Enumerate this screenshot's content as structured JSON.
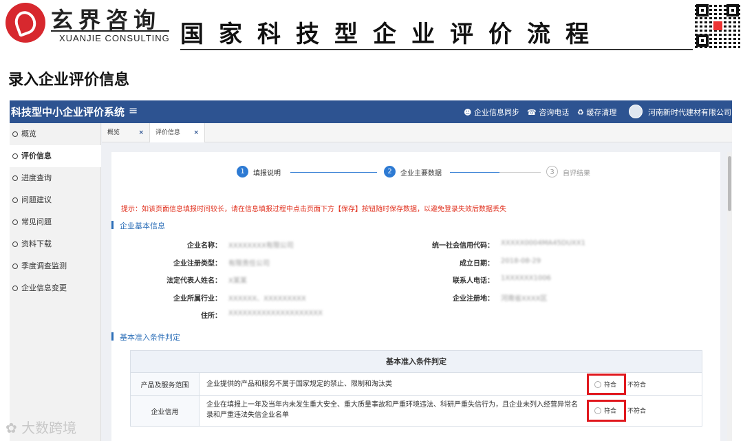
{
  "banner": {
    "brand_cn": "玄界咨询",
    "brand_en": "XUANJIE CONSULTING",
    "title": "国家科技型企业评价流程"
  },
  "section_heading": "录入企业评价信息",
  "app": {
    "system_title": "科技型中小企业评价系统",
    "menu_icon": "≡",
    "nav": [
      {
        "icon": "user-icon",
        "label": "企业信息同步"
      },
      {
        "icon": "phone-icon",
        "label": "咨询电话"
      },
      {
        "icon": "recycle-icon",
        "label": "缓存清理"
      }
    ],
    "company": "河南新时代建材有限公司",
    "sidebar": [
      "概览",
      "评价信息",
      "进度查询",
      "问题建议",
      "常见问题",
      "资料下载",
      "季度调查监测",
      "企业信息变更"
    ],
    "sidebar_active": "评价信息",
    "tabs": [
      {
        "label": "概览",
        "close": "×"
      },
      {
        "label": "评价信息",
        "close": "×"
      }
    ],
    "steps": [
      {
        "num": "1",
        "label": "填报说明"
      },
      {
        "num": "2",
        "label": "企业主要数据"
      },
      {
        "num": "3",
        "label": "自评结果"
      }
    ],
    "hint": "提示：如该页面信息填报时间较长，请在信息填报过程中点击页面下方【保存】按钮随时保存数据，以避免登录失效后数据丢失",
    "basic_info_title": "企业基本信息",
    "fields_left": [
      {
        "label": "企业名称：",
        "value": "XXXXXXXX有限公司"
      },
      {
        "label": "企业注册类型：",
        "value": "有限责任公司"
      },
      {
        "label": "法定代表人姓名：",
        "value": "X某某"
      },
      {
        "label": "企业所属行业：",
        "value": "XXXXXX、XXXXXXXXX"
      },
      {
        "label": "住所：",
        "value": "XXXXXXXXXXXXXXXXXXXX"
      }
    ],
    "fields_right": [
      {
        "label": "统一社会信用代码：",
        "value": "XXXXX0004MA45DUXX1"
      },
      {
        "label": "成立日期：",
        "value": "2018-08-29"
      },
      {
        "label": "联系人电话：",
        "value": "1XXXXXX1006"
      },
      {
        "label": "企业注册地：",
        "value": "河南省XXXX区"
      }
    ],
    "criteria_title": "基本准入条件判定",
    "table": {
      "header": "基本准入条件判定",
      "rows": [
        {
          "label": "产品及服务范围",
          "text": "企业提供的产品和服务不属于国家规定的禁止、限制和淘汰类",
          "yes": "符合",
          "no": "不符合"
        },
        {
          "label": "企业信用",
          "text": "企业在填报上一年及当年内未发生重大安全、重大质量事故和严重环境违法、科研严重失信行为，且企业未列入经营异常名录和严重违法失信企业名单",
          "yes": "符合",
          "no": "不符合"
        }
      ]
    }
  },
  "watermark": "大数跨境"
}
